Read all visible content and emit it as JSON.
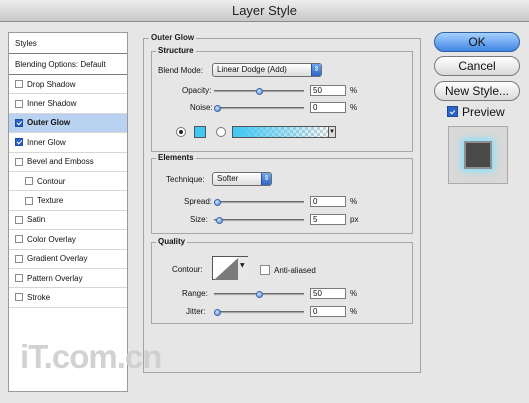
{
  "window": {
    "title": "Layer Style"
  },
  "left_panel": {
    "header": "Styles",
    "blending_options": "Blending Options: Default",
    "items": [
      {
        "label": "Drop Shadow",
        "checked": false,
        "selected": false,
        "indent": false
      },
      {
        "label": "Inner Shadow",
        "checked": false,
        "selected": false,
        "indent": false
      },
      {
        "label": "Outer Glow",
        "checked": true,
        "selected": true,
        "indent": false
      },
      {
        "label": "Inner Glow",
        "checked": true,
        "selected": false,
        "indent": false
      },
      {
        "label": "Bevel and Emboss",
        "checked": false,
        "selected": false,
        "indent": false
      },
      {
        "label": "Contour",
        "checked": false,
        "selected": false,
        "indent": true
      },
      {
        "label": "Texture",
        "checked": false,
        "selected": false,
        "indent": true
      },
      {
        "label": "Satin",
        "checked": false,
        "selected": false,
        "indent": false
      },
      {
        "label": "Color Overlay",
        "checked": false,
        "selected": false,
        "indent": false
      },
      {
        "label": "Gradient Overlay",
        "checked": false,
        "selected": false,
        "indent": false
      },
      {
        "label": "Pattern Overlay",
        "checked": false,
        "selected": false,
        "indent": false
      },
      {
        "label": "Stroke",
        "checked": false,
        "selected": false,
        "indent": false
      }
    ]
  },
  "outer_glow": {
    "title": "Outer Glow",
    "structure": {
      "title": "Structure",
      "blend_mode_label": "Blend Mode:",
      "blend_mode_value": "Linear Dodge (Add)",
      "opacity_label": "Opacity:",
      "opacity_value": "50",
      "opacity_unit": "%",
      "opacity_level": 50,
      "noise_label": "Noise:",
      "noise_value": "0",
      "noise_unit": "%",
      "noise_level": 0,
      "glow_color": "#3fc7f3",
      "color_mode": "solid"
    },
    "elements": {
      "title": "Elements",
      "technique_label": "Technique:",
      "technique_value": "Softer",
      "spread_label": "Spread:",
      "spread_value": "0",
      "spread_unit": "%",
      "spread_level": 0,
      "size_label": "Size:",
      "size_value": "5",
      "size_unit": "px",
      "size_level": 5
    },
    "quality": {
      "title": "Quality",
      "contour_label": "Contour:",
      "anti_aliased_label": "Anti-aliased",
      "anti_aliased": false,
      "range_label": "Range:",
      "range_value": "50",
      "range_unit": "%",
      "range_level": 50,
      "jitter_label": "Jitter:",
      "jitter_value": "0",
      "jitter_unit": "%",
      "jitter_level": 0
    }
  },
  "buttons": {
    "ok": "OK",
    "cancel": "Cancel",
    "new_style": "New Style...",
    "preview_label": "Preview",
    "preview_checked": true
  },
  "watermark": "iT.com.cn"
}
